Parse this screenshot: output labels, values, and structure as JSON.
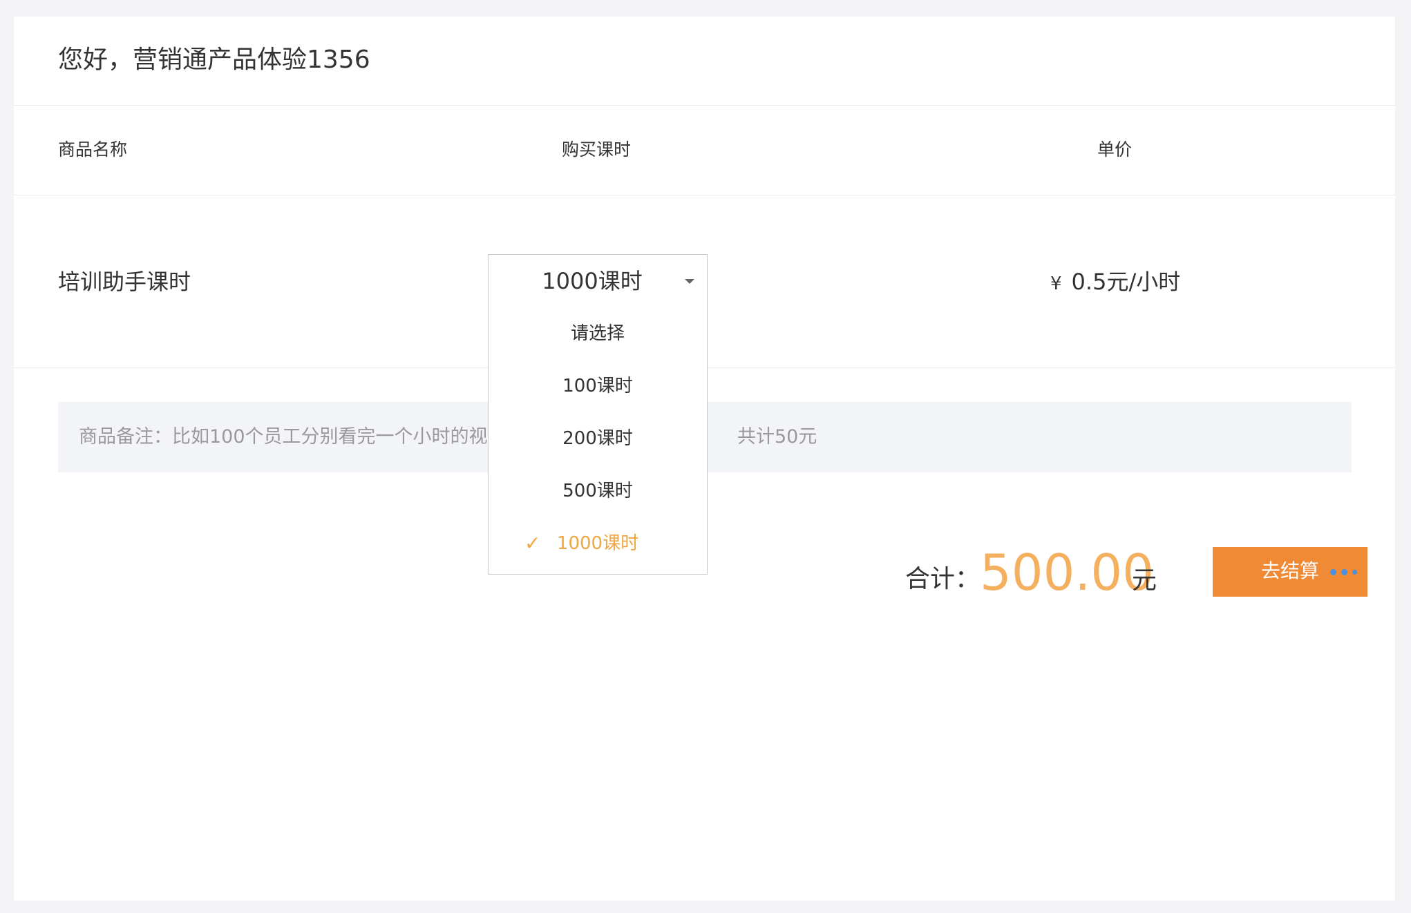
{
  "header": {
    "greeting": "您好，营销通产品体验1356"
  },
  "table": {
    "columns": [
      "商品名称",
      "购买课时",
      "单价"
    ],
    "row": {
      "name": "培训助手课时",
      "hours_selected": "1000课时",
      "price_symbol": "¥",
      "price": "0.5元/小时"
    }
  },
  "dropdown": {
    "options": [
      "请选择",
      "100课时",
      "200课时",
      "500课时",
      "1000课时"
    ],
    "selected_index": 4,
    "check_mark": "✓"
  },
  "note": {
    "text_left": "商品备注：比如100个员工分别看完一个小时的视",
    "text_right": "共计50元"
  },
  "summary": {
    "label": "合计：",
    "amount": "500.00",
    "unit": "元"
  },
  "checkout": {
    "label": "去结算"
  },
  "colors": {
    "accent_orange": "#f08a34",
    "amount_orange": "#f5b05f",
    "selected_option": "#f0a641",
    "loading_dots": "#4a90e2"
  }
}
